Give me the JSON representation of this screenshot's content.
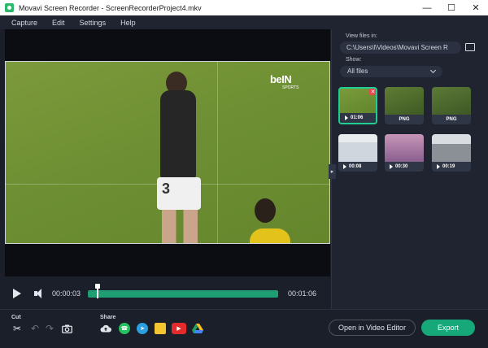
{
  "window": {
    "title": "Movavi Screen Recorder - ScreenRecorderProject4.mkv",
    "minimize_glyph": "—",
    "maximize_glyph": "☐",
    "close_glyph": "✕"
  },
  "menu": [
    "Capture",
    "Edit",
    "Settings",
    "Help"
  ],
  "video": {
    "brand_text": "beIN",
    "brand_sub": "SPORTS",
    "jersey_number": "3"
  },
  "player": {
    "current_time": "00:00:03",
    "total_time": "00:01:06",
    "progress_fraction": 0.05
  },
  "bottom": {
    "cut_label": "Cut",
    "share_label": "Share",
    "open_editor_label": "Open in Video Editor",
    "export_label": "Export"
  },
  "files": {
    "view_label": "View files in:",
    "path": "C:\\Users\\l\\Videos\\Movavi Screen R",
    "show_label": "Show:",
    "filter": "All files",
    "items": [
      {
        "type": "video",
        "badge": "01:06",
        "selected": true
      },
      {
        "type": "image",
        "badge": "PNG",
        "selected": false
      },
      {
        "type": "image",
        "badge": "PNG",
        "selected": false
      },
      {
        "type": "video",
        "badge": "00:08",
        "selected": false
      },
      {
        "type": "video",
        "badge": "00:30",
        "selected": false
      },
      {
        "type": "video",
        "badge": "00:19",
        "selected": false
      }
    ]
  },
  "colors": {
    "accent": "#16a878",
    "track": "#1f9d73",
    "background": "#1b1f2a",
    "panel": "#1f2430"
  },
  "icons": {
    "share": [
      "cloud-upload-icon",
      "whatsapp-icon",
      "telegram-icon",
      "google-drive-folder-icon",
      "youtube-icon",
      "google-drive-icon"
    ],
    "tools": [
      "scissors-icon",
      "undo-icon",
      "redo-icon",
      "camera-icon"
    ]
  }
}
